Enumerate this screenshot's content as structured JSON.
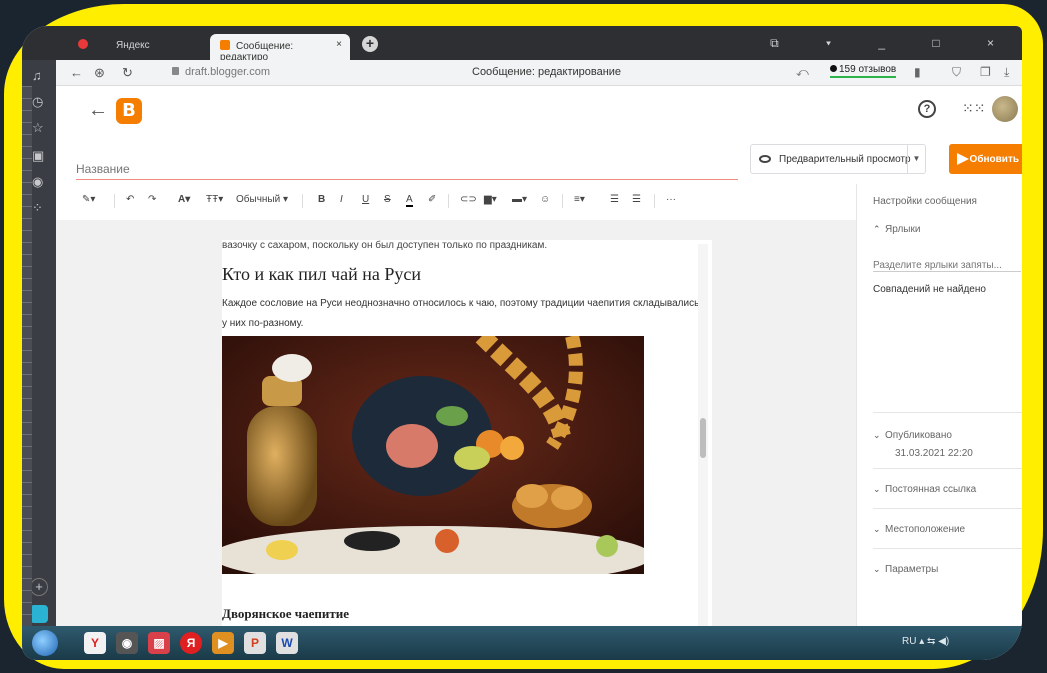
{
  "browser": {
    "tabs": [
      {
        "label": "Яндекс"
      },
      {
        "label": "Сообщение: редактиро",
        "close": "×"
      }
    ],
    "new_tab": "+",
    "window_controls": "⧉ ▾ _ □ ×",
    "url": "draft.blogger.com",
    "page_title": "Сообщение: редактирование",
    "reviews": "159 отзывов"
  },
  "blogger": {
    "logo_letter": "B",
    "help": "?",
    "title_placeholder": "Название",
    "preview_label": "Предварительный просмотр",
    "update_label": "Обновить"
  },
  "toolbar": {
    "format_style": "Обычный"
  },
  "article": {
    "cut_line": "вазочку с сахаром, поскольку он был доступен только по праздникам.",
    "heading": "Кто и как пил чай на Руси",
    "paragraph": "Каждое сословие на Руси неоднозначно относилось к чаю, поэтому традиции чаепития складывались у них по-разному.",
    "subheading": "Дворянское чаепитие"
  },
  "settings": {
    "title": "Настройки сообщения",
    "labels_section": "Ярлыки",
    "labels_placeholder": "Разделите ярлыки запяты...",
    "no_match": "Совпадений не найдено",
    "published_label": "Опубликовано",
    "published_date": "31.03.2021 22:20",
    "permalink": "Постоянная ссылка",
    "location": "Местоположение",
    "options": "Параметры"
  },
  "taskbar": {
    "tray": "RU",
    "tray_icons": "▴ ⇆ ◀)"
  },
  "colors": {
    "accent": "#f57d00",
    "frame": "#ffee00"
  }
}
